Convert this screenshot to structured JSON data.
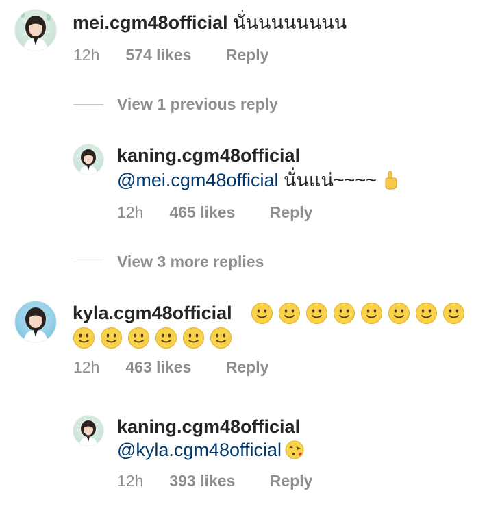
{
  "colors": {
    "username": "#262626",
    "meta": "#8e8e8e",
    "mention": "#00376b",
    "divider": "#c7c7c7",
    "smiley_fill": "#f7d24a"
  },
  "comments": [
    {
      "username": "mei.cgm48official",
      "text": "นั่นนนนนนนน",
      "time": "12h",
      "likes": "574 likes",
      "reply_label": "Reply",
      "avatar_icon": "profile-avatar"
    },
    {
      "username": "kyla.cgm48official",
      "emoji": "smiling-face",
      "emoji_count": 14,
      "time": "12h",
      "likes": "463 likes",
      "reply_label": "Reply",
      "avatar_icon": "profile-avatar"
    }
  ],
  "replies": [
    {
      "username": "kaning.cgm48official",
      "mention": "@mei.cgm48official",
      "text": "นั่นแน่~~~~",
      "emoji": "index-pointing-up",
      "time": "12h",
      "likes": "465 likes",
      "reply_label": "Reply",
      "avatar_icon": "profile-avatar"
    },
    {
      "username": "kaning.cgm48official",
      "mention": "@kyla.cgm48official",
      "emoji": "face-blowing-kiss",
      "time": "12h",
      "likes": "393 likes",
      "reply_label": "Reply",
      "avatar_icon": "profile-avatar"
    }
  ],
  "view_replies": [
    {
      "label": "View 1 previous reply"
    },
    {
      "label": "View 3 more replies"
    }
  ]
}
